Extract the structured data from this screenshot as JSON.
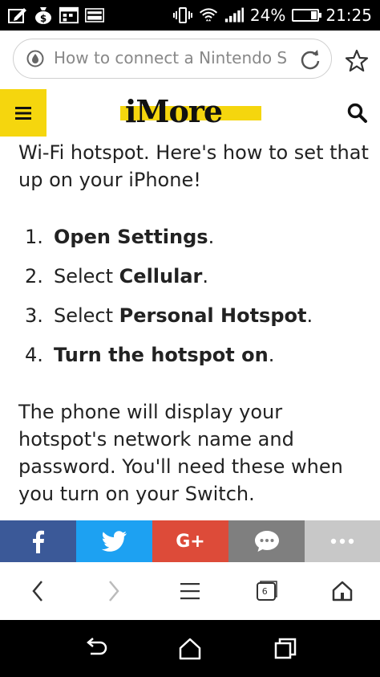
{
  "status_bar": {
    "battery": "24%",
    "battery_level": 0.24,
    "time": "21:25"
  },
  "browser": {
    "url_text": "How to connect a Nintendo S",
    "tab_count": "6"
  },
  "site": {
    "logo": "iMore"
  },
  "article": {
    "intro": "Wi-Fi hotspot. Here's how to set that up on your iPhone!",
    "steps": [
      {
        "num": "1.",
        "pre": "",
        "bold": "Open Settings",
        "post": "."
      },
      {
        "num": "2.",
        "pre": "Select ",
        "bold": "Cellular",
        "post": "."
      },
      {
        "num": "3.",
        "pre": "Select ",
        "bold": "Personal Hotspot",
        "post": "."
      },
      {
        "num": "4.",
        "pre": "",
        "bold": "Turn the hotspot on",
        "post": "."
      }
    ],
    "after": "The phone will display your hotspot's network name and password. You'll need these when you turn on your Switch."
  },
  "share": [
    {
      "icon": "facebook-icon",
      "color": "#3b5998"
    },
    {
      "icon": "twitter-icon",
      "color": "#1da1f2"
    },
    {
      "icon": "google-plus-icon",
      "color": "#dd4b39",
      "label": "G+"
    },
    {
      "icon": "comment-icon",
      "color": "#7f7f7f"
    },
    {
      "icon": "more-icon",
      "color": "#c8c8c8"
    }
  ],
  "colors": {
    "accent": "#f5d60e"
  }
}
